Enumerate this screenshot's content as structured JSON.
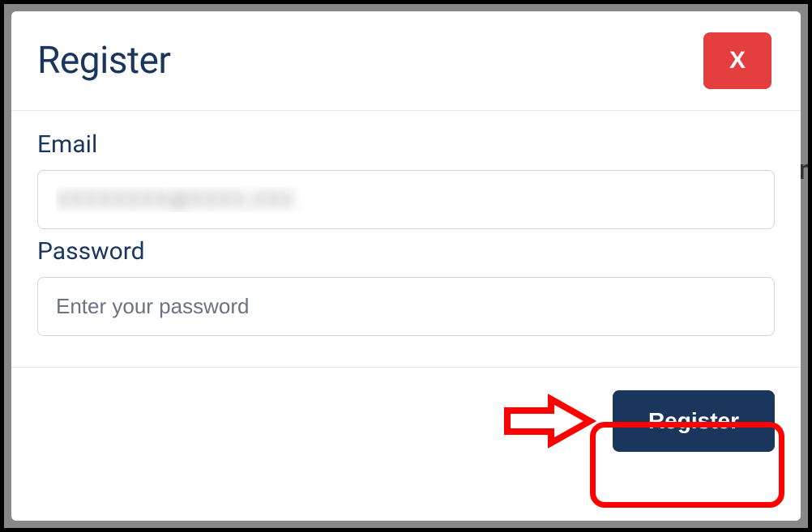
{
  "modal": {
    "title": "Register",
    "close_label": "X"
  },
  "form": {
    "email_label": "Email",
    "email_value": "XXXXXXXX@XXXX.XXX",
    "password_label": "Password",
    "password_placeholder": "Enter your password"
  },
  "footer": {
    "submit_label": "Register"
  },
  "background": {
    "peek_letter": "n"
  }
}
